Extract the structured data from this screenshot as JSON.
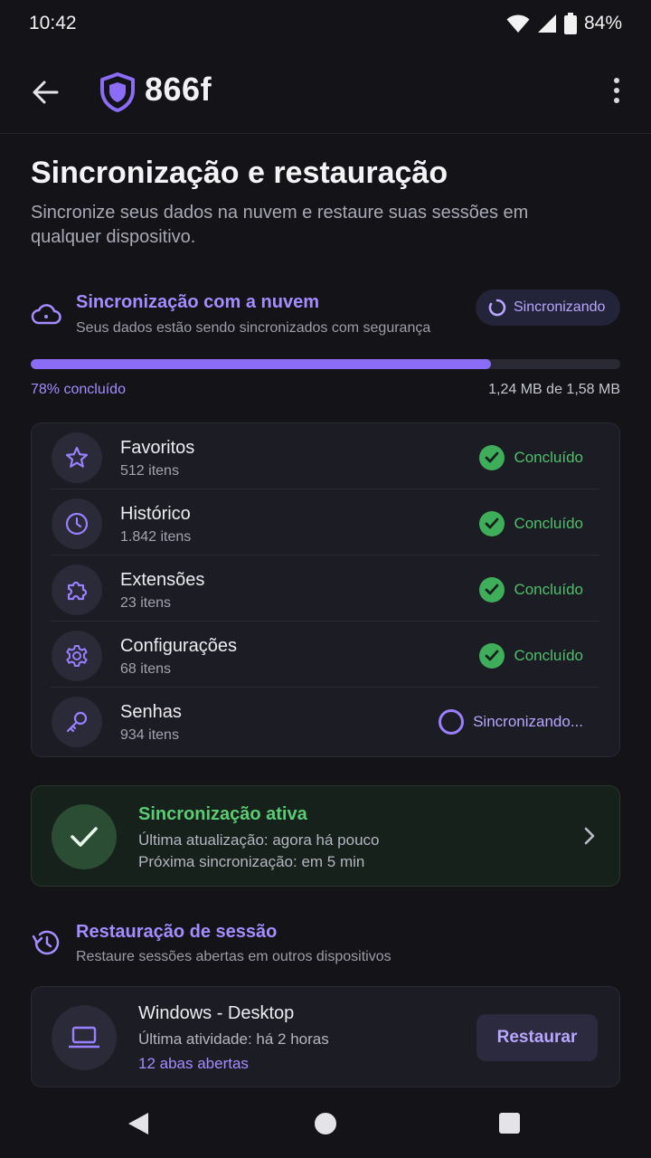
{
  "status_bar": {
    "time": "10:42",
    "battery": "84%"
  },
  "app_bar": {
    "brand": "866f"
  },
  "page": {
    "title": "Sincronização e restauração",
    "subtitle": "Sincronize seus dados na nuvem e restaure suas sessões em qualquer dispositivo."
  },
  "cloud_sync": {
    "title": "Sincronização com a nuvem",
    "description": "Seus dados estão sendo sincronizados com segurança",
    "chip_label": "Sincronizando",
    "progress": 0.78,
    "progress_label": "78% concluído",
    "size_label": "1,24 MB de 1,58 MB"
  },
  "items": [
    {
      "name": "Favoritos",
      "count": "512 itens",
      "status": "Concluído",
      "state": "done",
      "icon": "star-icon"
    },
    {
      "name": "Histórico",
      "count": "1.842 itens",
      "status": "Concluído",
      "state": "done",
      "icon": "clock-icon"
    },
    {
      "name": "Extensões",
      "count": "23 itens",
      "status": "Concluído",
      "state": "done",
      "icon": "puzzle-icon"
    },
    {
      "name": "Configurações",
      "count": "68 itens",
      "status": "Concluído",
      "state": "done",
      "icon": "gear-icon"
    },
    {
      "name": "Senhas",
      "count": "934 itens",
      "status": "Sincronizando...",
      "state": "progress",
      "icon": "key-icon"
    }
  ],
  "active_sync": {
    "title": "Sincronização ativa",
    "last_update": "Última atualização: agora há pouco",
    "next_sync": "Próxima sincronização: em 5 min"
  },
  "session_restore": {
    "title": "Restauração de sessão",
    "description": "Restaure sessões abertas em outros dispositivos"
  },
  "device": {
    "name": "Windows - Desktop",
    "activity": "Última atividade: há 2 horas",
    "tabs": "12 abas abertas",
    "button": "Restaurar"
  },
  "colors": {
    "accent": "#a58cff",
    "success": "#4fbf6a",
    "background": "#131318"
  }
}
